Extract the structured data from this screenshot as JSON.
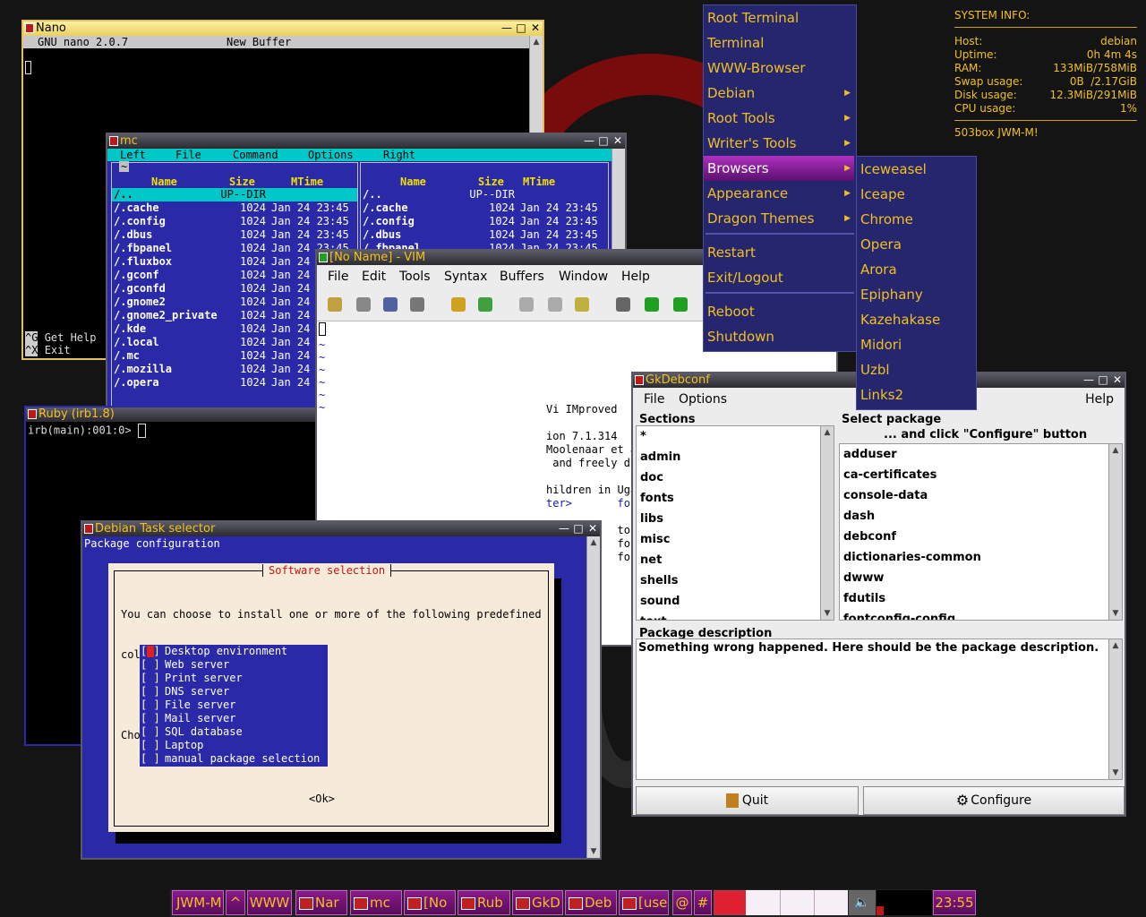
{
  "desktop": {
    "sysinfo": {
      "header": "SYSTEM INFO:",
      "rows": [
        {
          "label": "Host:",
          "value": "debian"
        },
        {
          "label": "Uptime:",
          "value": "0h 4m 4s"
        },
        {
          "label": "RAM:",
          "value": "133MiB/758MiB"
        },
        {
          "label": "Swap usage:",
          "value": "0B  /2.17GiB"
        },
        {
          "label": "Disk usage:",
          "value": "12.3MiB/291MiB"
        },
        {
          "label": "CPU usage:",
          "value": "1%"
        }
      ],
      "footer": "503box JWM-M!"
    }
  },
  "nano": {
    "title": "Nano",
    "header_left": "GNU nano 2.0.7",
    "header_center": "New Buffer",
    "help": [
      {
        "key": "^G",
        "label": "Get Help"
      },
      {
        "key": "^X",
        "label": "Exit"
      }
    ]
  },
  "mc": {
    "title": "mc",
    "menubar": [
      "Left",
      "File",
      "Command",
      "Options",
      "Right"
    ],
    "left_path": "~",
    "cols": {
      "name": "Name",
      "size": "Size",
      "mtime": "MTime"
    },
    "left_rows": [
      {
        "name": "/..",
        "size": "UP--DIR",
        "mtime": ""
      },
      {
        "name": "/.cache",
        "size": "1024",
        "mtime": "Jan 24 23:45"
      },
      {
        "name": "/.config",
        "size": "1024",
        "mtime": "Jan 24 23:45"
      },
      {
        "name": "/.dbus",
        "size": "1024",
        "mtime": "Jan 24 23:45"
      },
      {
        "name": "/.fbpanel",
        "size": "1024",
        "mtime": "Jan 24 23:45"
      },
      {
        "name": "/.fluxbox",
        "size": "1024",
        "mtime": "Jan 24"
      },
      {
        "name": "/.gconf",
        "size": "1024",
        "mtime": "Jan 24"
      },
      {
        "name": "/.gconfd",
        "size": "1024",
        "mtime": "Jan 24"
      },
      {
        "name": "/.gnome2",
        "size": "1024",
        "mtime": "Jan 24"
      },
      {
        "name": "/.gnome2_private",
        "size": "1024",
        "mtime": "Jan 24"
      },
      {
        "name": "/.kde",
        "size": "1024",
        "mtime": "Jan 24"
      },
      {
        "name": "/.local",
        "size": "1024",
        "mtime": "Jan 24"
      },
      {
        "name": "/.mc",
        "size": "1024",
        "mtime": "Jan 24"
      },
      {
        "name": "/.mozilla",
        "size": "1024",
        "mtime": "Jan 24"
      },
      {
        "name": "/.opera",
        "size": "1024",
        "mtime": "Jan 24"
      }
    ],
    "right_path": "~",
    "right_rows": [
      {
        "name": "/..",
        "size": "UP--DIR",
        "mtime": ""
      },
      {
        "name": "/.cache",
        "size": "1024",
        "mtime": "Jan 24 23:45"
      },
      {
        "name": "/.config",
        "size": "1024",
        "mtime": "Jan 24 23:45"
      },
      {
        "name": "/.dbus",
        "size": "1024",
        "mtime": "Jan 24 23:45"
      },
      {
        "name": "/.fbpanel",
        "size": "1024",
        "mtime": "Jan 24 23:45"
      }
    ]
  },
  "vim": {
    "title": "[No Name] - VIM",
    "menubar": [
      "File",
      "Edit",
      "Tools",
      "Syntax",
      "Buffers",
      "Window",
      "Help"
    ],
    "splash": [
      {
        "text": "Vi IMproved",
        "color": "#000"
      },
      {
        "text": "",
        "color": "#000"
      },
      {
        "text": "ion 7.1.314",
        "color": "#000"
      },
      {
        "text": "Moolenaar et a",
        "color": "#000"
      },
      {
        "text": " and freely di",
        "color": "#000"
      },
      {
        "text": "",
        "color": "#000"
      },
      {
        "text": "hildren in Uga",
        "color": "#000"
      },
      {
        "text": "ter>       for",
        "color": "#1a1aa0"
      },
      {
        "text": "",
        "color": "#000"
      },
      {
        "text": "           to",
        "color": "#000"
      },
      {
        "text": "           for",
        "color": "#000"
      },
      {
        "text": "           for",
        "color": "#000"
      }
    ]
  },
  "ruby": {
    "title": "Ruby (irb1.8)",
    "prompt": "irb(main):001:0> "
  },
  "tasksel": {
    "title": "Debian Task selector",
    "subtitle": "Package configuration",
    "dialog_title": "Software selection",
    "intro_line1": "You can choose to install one or more of the following predefined",
    "intro_line2": "collections of software.",
    "choose": "Choose software to install:",
    "items": [
      {
        "check": "[*]",
        "label": "Desktop environment"
      },
      {
        "check": "[ ]",
        "label": "Web server"
      },
      {
        "check": "[ ]",
        "label": "Print server"
      },
      {
        "check": "[ ]",
        "label": "DNS server"
      },
      {
        "check": "[ ]",
        "label": "File server"
      },
      {
        "check": "[ ]",
        "label": "Mail server"
      },
      {
        "check": "[ ]",
        "label": "SQL database"
      },
      {
        "check": "[ ]",
        "label": "Laptop"
      },
      {
        "check": "[ ]",
        "label": "manual package selection"
      }
    ],
    "ok": "<Ok>"
  },
  "menu": {
    "items": [
      {
        "label": "Root Terminal",
        "sub": false
      },
      {
        "label": "Terminal",
        "sub": false
      },
      {
        "label": "WWW-Browser",
        "sub": false
      },
      {
        "label": "Debian",
        "sub": true
      },
      {
        "label": "Root Tools",
        "sub": true
      },
      {
        "label": "Writer's Tools",
        "sub": true
      },
      {
        "label": "Browsers",
        "sub": true
      },
      {
        "label": "Appearance",
        "sub": true
      },
      {
        "label": "Dragon Themes",
        "sub": true
      },
      {
        "label": "Restart",
        "sub": false
      },
      {
        "label": "Exit/Logout",
        "sub": false
      },
      {
        "label": "Reboot",
        "sub": false
      },
      {
        "label": "Shutdown",
        "sub": false
      }
    ],
    "browsers": [
      "Iceweasel",
      "Iceape",
      "Chrome",
      "Opera",
      "Arora",
      "Epiphany",
      "Kazehakase",
      "Midori",
      "Uzbl",
      "Links2"
    ]
  },
  "gkdebconf": {
    "title": "GkDebconf",
    "menu_file": "File",
    "menu_options": "Options",
    "menu_help": "Help",
    "sections_label": "Sections",
    "sections": [
      "*",
      "admin",
      "doc",
      "fonts",
      "libs",
      "misc",
      "net",
      "shells",
      "sound",
      "text"
    ],
    "select_label": "Select package",
    "select_hint": "... and click \"Configure\" button",
    "packages": [
      "adduser",
      "ca-certificates",
      "console-data",
      "dash",
      "debconf",
      "dictionaries-common",
      "dwww",
      "fdutils",
      "fontconfig-config"
    ],
    "desc_label": "Package description",
    "desc_text": "Something wrong happened. Here should be the package description.",
    "quit": "Quit",
    "configure": "Configure"
  },
  "taskbar": {
    "start": "JWM-M",
    "up": "^",
    "www": "WWW",
    "tasks": [
      "Nar",
      "mc",
      "[No",
      "Rub",
      "GkD",
      "Deb",
      "[use"
    ],
    "at": "@",
    "hash": "#",
    "clock": "23:55"
  },
  "colors": {
    "accent": "#f0c020",
    "menu_bg": "#26266e",
    "mc_blue": "#2a2aa8",
    "mc_cyan": "#00c8c8",
    "task_purple": "#7a167a"
  }
}
